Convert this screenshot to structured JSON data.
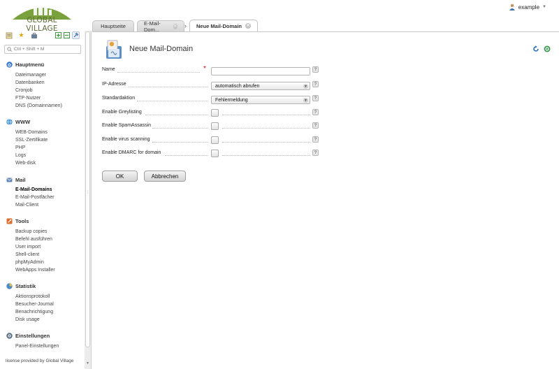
{
  "logo": {
    "text": "GLOBAL VILLAGE"
  },
  "user": {
    "name": "example"
  },
  "tabs": [
    {
      "label": "Hauptseite",
      "closable": false,
      "active": false
    },
    {
      "label": "E-Mail-Dom...",
      "closable": true,
      "active": false
    },
    {
      "label": "Neue Mail-Domain",
      "closable": true,
      "active": true
    }
  ],
  "sidebar": {
    "search_placeholder": "Ctrl + Shift + M",
    "sections": [
      {
        "title": "Hauptmenü",
        "icon": "home-icon",
        "color": "#3a7bd5",
        "items": [
          "Dateimanager",
          "Datenbanken",
          "Cronjob",
          "FTP-Nutzer",
          "DNS (Domainnamen)"
        ]
      },
      {
        "title": "WWW",
        "icon": "globe-icon",
        "color": "#3b8fd8",
        "items": [
          "WEB-Domains",
          "SSL-Zertifikate",
          "PHP",
          "Logs",
          "Web-disk"
        ]
      },
      {
        "title": "Mail",
        "icon": "mail-icon",
        "color": "#5f87b8",
        "items": [
          "E-Mail-Domains",
          "E-Mail-Postfächer",
          "Mail-Client"
        ],
        "active_item": "E-Mail-Domains"
      },
      {
        "title": "Tools",
        "icon": "tools-icon",
        "color": "#e06c2c",
        "items": [
          "Backup copies",
          "Befehl ausführen",
          "User import",
          "Shell-client",
          "phpMyAdmin",
          "WebApps Installer"
        ]
      },
      {
        "title": "Statistik",
        "icon": "statistics-icon",
        "color": "#4b8ac9",
        "items": [
          "Aktionsprotokoll",
          "Besucher-Journal",
          "Benachrichtigung",
          "Disk usage"
        ]
      },
      {
        "title": "Einstellungen",
        "icon": "settings-icon",
        "color": "#5a6f86",
        "items": [
          "Panel-Einstellungen"
        ]
      }
    ],
    "license": "license provided by Global Village"
  },
  "form": {
    "title": "Neue Mail-Domain",
    "fields": {
      "name": {
        "label": "Name",
        "value": "",
        "required": true
      },
      "ip": {
        "label": "IP-Adresse",
        "value": "automatisch abrufen"
      },
      "default_action": {
        "label": "Standardaktion",
        "value": "Fehlermeldung"
      },
      "greylisting": {
        "label": "Enable Greylisting",
        "checked": false
      },
      "spamassassin": {
        "label": "Enable SpamAssassin",
        "checked": false
      },
      "virus": {
        "label": "Enable virus scanning",
        "checked": false
      },
      "dmarc": {
        "label": "Enable DMARC for domain",
        "checked": false
      }
    },
    "help_glyph": "?",
    "required_glyph": "*",
    "ok_label": "OK",
    "cancel_label": "Abbrechen"
  }
}
